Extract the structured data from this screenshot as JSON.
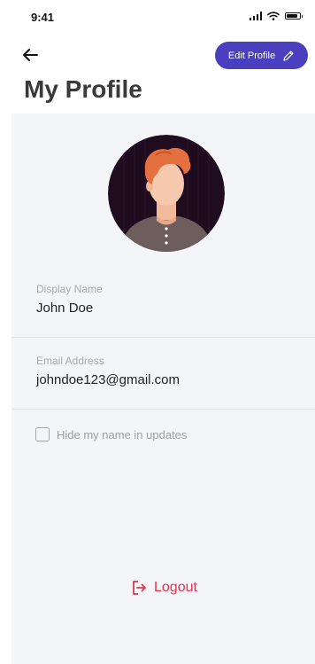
{
  "status_bar": {
    "time": "9:41"
  },
  "header": {
    "edit_label": "Edit Profile",
    "title": "My Profile"
  },
  "profile": {
    "display_name_label": "Display Name",
    "display_name": "John Doe",
    "email_label": "Email Address",
    "email": "johndoe123@gmail.com",
    "hide_name_label": "Hide my name in updates",
    "hide_name_checked": false
  },
  "logout_label": "Logout",
  "icons": {
    "back": "arrow-left-icon",
    "edit": "pencil-icon",
    "logout": "logout-icon",
    "signal": "cellular-signal-icon",
    "wifi": "wifi-icon",
    "battery": "battery-icon"
  },
  "colors": {
    "accent": "#4a3fbf",
    "danger": "#e0364f",
    "card_background": "#f4f5f8",
    "avatar_background": "#1f0c1f",
    "hair": "#e5703f"
  }
}
